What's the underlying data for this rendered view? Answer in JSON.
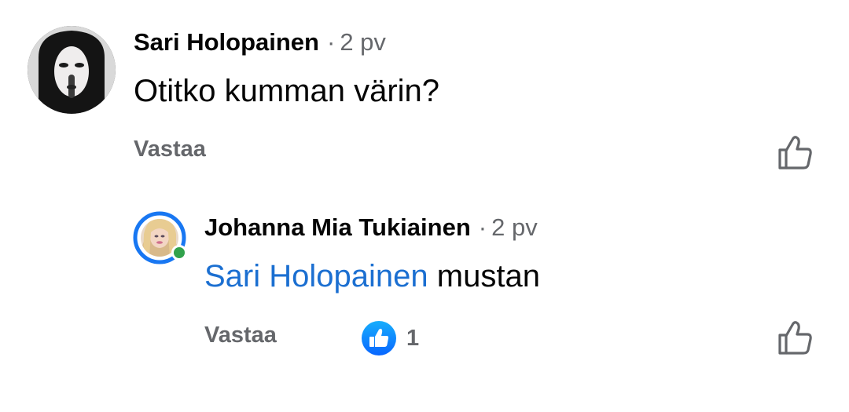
{
  "comments": [
    {
      "author": "Sari Holopainen",
      "time": "2 pv",
      "separator": "·",
      "text": "Otitko kumman värin?",
      "reply_label": "Vastaa",
      "like_icon": "thumbs-up-outline-icon"
    }
  ],
  "replies": [
    {
      "author": "Johanna Mia Tukiainen",
      "time": "2 pv",
      "separator": "·",
      "mention": "Sari Holopainen",
      "text": "mustan",
      "reply_label": "Vastaa",
      "reaction_count": "1",
      "reaction_icon": "like-reaction-icon",
      "like_icon": "thumbs-up-outline-icon",
      "online": true
    }
  ],
  "colors": {
    "mention": "#1b6fd1",
    "secondary_text": "#65676b",
    "story_ring": "#1877f2",
    "online_dot": "#31a24c"
  }
}
